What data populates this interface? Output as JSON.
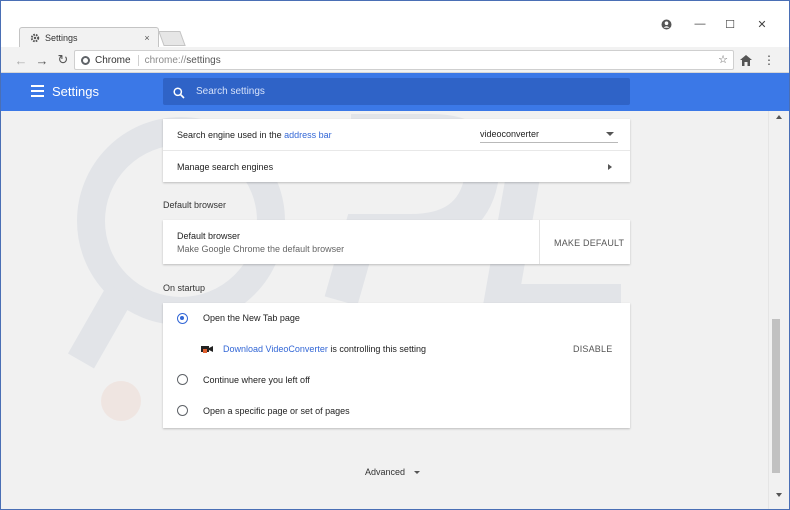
{
  "tab": {
    "title": "Settings",
    "close": "×"
  },
  "window_controls": {
    "minimize": "—",
    "maximize": "☐",
    "close": "✕"
  },
  "toolbar": {
    "site_chip": "Chrome",
    "url_scheme": "chrome://",
    "url_path": "settings"
  },
  "header": {
    "title": "Settings",
    "search_placeholder": "Search settings"
  },
  "search_engine": {
    "label_prefix": "Search engine used in the ",
    "label_link": "address bar",
    "selected": "videoconverter",
    "manage_label": "Manage search engines"
  },
  "default_browser": {
    "section_title": "Default browser",
    "row_title": "Default browser",
    "row_subtitle": "Make Google Chrome the default browser",
    "button": "MAKE DEFAULT"
  },
  "on_startup": {
    "section_title": "On startup",
    "options": [
      {
        "label": "Open the New Tab page",
        "checked": true
      },
      {
        "label": "Continue where you left off",
        "checked": false
      },
      {
        "label": "Open a specific page or set of pages",
        "checked": false
      }
    ],
    "extension_notice": {
      "link": "Download VideoConverter",
      "text": " is controlling this setting",
      "button": "DISABLE"
    }
  },
  "advanced": {
    "label": "Advanced"
  },
  "colors": {
    "header_blue": "#3b78e7",
    "search_box_blue": "#2f63c7",
    "link_blue": "#3367d6"
  }
}
